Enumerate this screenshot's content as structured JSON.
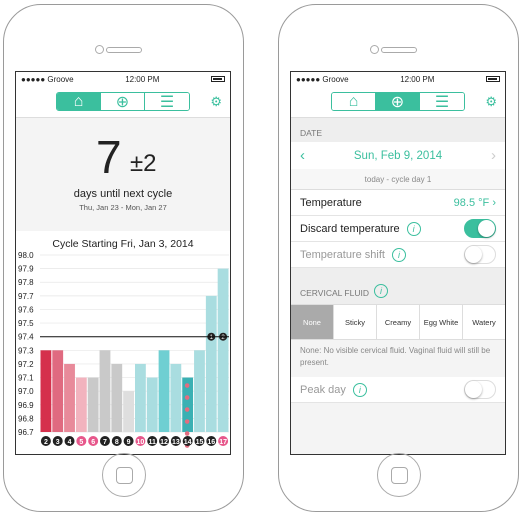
{
  "status": {
    "carrier": "Groove",
    "time": "12:00 PM"
  },
  "screen1": {
    "days": "7",
    "plusminus": "±2",
    "days_label": "days until next cycle",
    "date_range": "Thu, Jan 23 - Mon, Jan 27",
    "chart_title": "Cycle Starting Fri, Jan 3, 2014"
  },
  "chart_data": {
    "type": "bar",
    "title": "Cycle Starting Fri, Jan 3, 2014",
    "ylim": [
      96.7,
      98.0
    ],
    "yticks": [
      "98.0",
      "97.9",
      "97.8",
      "97.7",
      "97.6",
      "97.5",
      "97.4",
      "97.3",
      "97.2",
      "97.1",
      "97.0",
      "96.9",
      "96.8",
      "96.7"
    ],
    "coverline": 97.4,
    "categories": [
      "2",
      "3",
      "4",
      "5",
      "6",
      "7",
      "8",
      "9",
      "10",
      "11",
      "12",
      "13",
      "14",
      "15",
      "16",
      "17"
    ],
    "values": [
      97.3,
      97.3,
      97.2,
      97.1,
      97.1,
      97.3,
      97.2,
      97.0,
      97.2,
      97.1,
      97.3,
      97.2,
      97.1,
      97.3,
      97.7,
      97.9
    ],
    "colors": [
      "#d5304c",
      "#e06a80",
      "#e88a9a",
      "#f2b3be",
      "#c9c9c9",
      "#c9c9c9",
      "#c9c9c9",
      "#dedede",
      "#a9dde0",
      "#a9dde0",
      "#6fcfd2",
      "#a9dde0",
      "#3ab0b3",
      "#a9dde0",
      "#a9dde0",
      "#a9dde0"
    ],
    "label_style": [
      "dark",
      "dark",
      "dark",
      "pink",
      "pink",
      "dark",
      "dark",
      "dark",
      "pinkheart",
      "dark",
      "dark",
      "dark",
      "dark",
      "dark",
      "dark",
      "pinkheart"
    ],
    "markers": [
      "",
      "",
      "",
      "",
      "",
      "",
      "",
      "",
      "",
      "",
      "",
      "",
      "",
      "",
      "1",
      "2"
    ]
  },
  "screen2": {
    "date_section": "DATE",
    "date": "Sun, Feb 9, 2014",
    "cycle_day": "today - cycle day 1",
    "temperature_label": "Temperature",
    "temperature_value": "98.5 °F",
    "discard_label": "Discard temperature",
    "shift_label": "Temperature shift",
    "fluid_section": "CERVICAL FLUID",
    "fluid_options": [
      "None",
      "Sticky",
      "Creamy",
      "Egg White",
      "Watery"
    ],
    "fluid_desc": "None: No visible cervical fluid. Vaginal fluid will still be present.",
    "peak_label": "Peak day"
  },
  "colors": {
    "accent": "#3bbf9e"
  }
}
